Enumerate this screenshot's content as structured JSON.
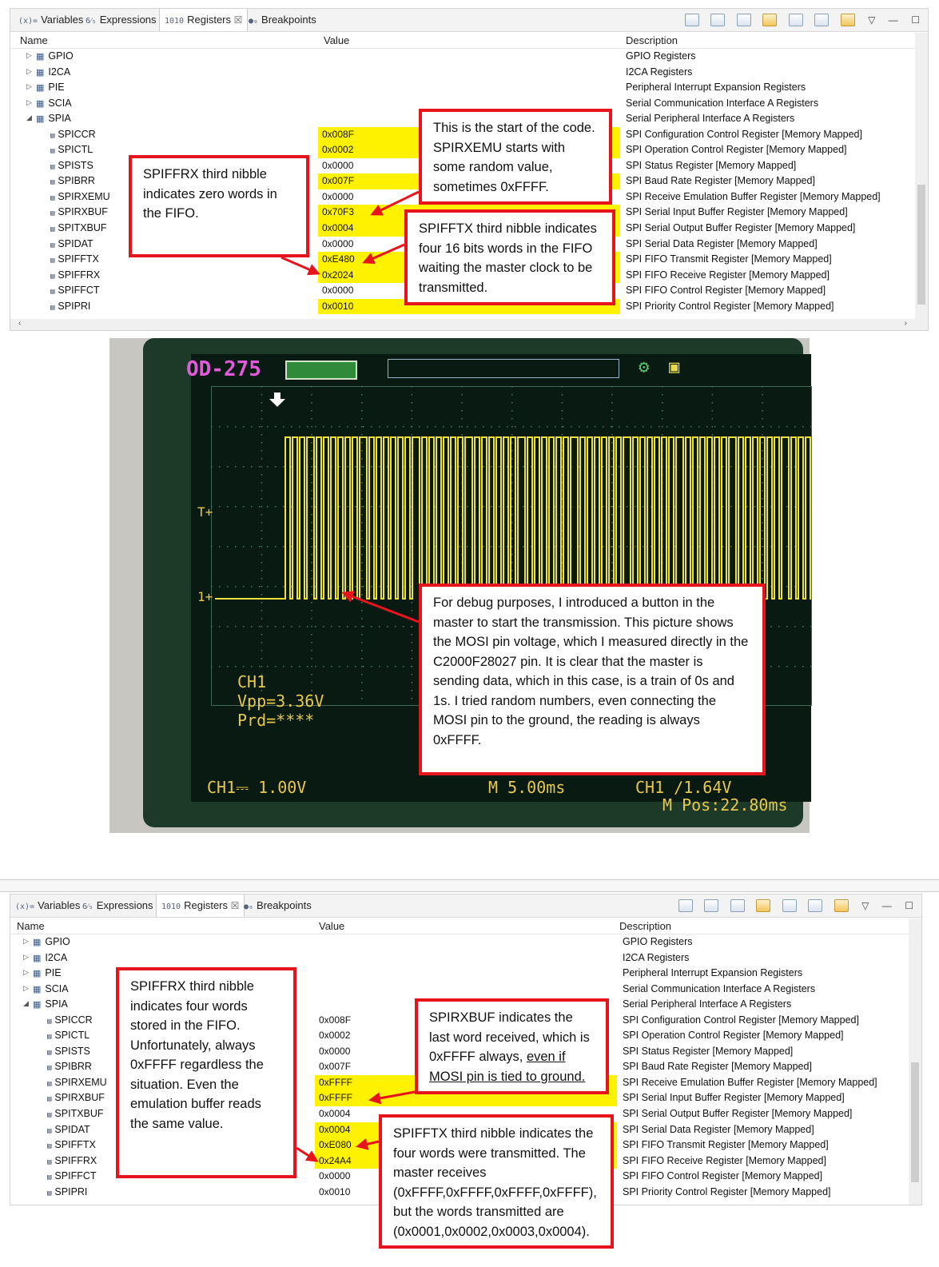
{
  "tabs": [
    {
      "icon": "(x)=",
      "label": "Variables"
    },
    {
      "icon": "6⁄₅",
      "label": "Expressions"
    },
    {
      "icon": "1010",
      "label": "Registers",
      "close": "☒"
    },
    {
      "icon": "●₀",
      "label": "Breakpoints"
    }
  ],
  "columns": {
    "name": "Name",
    "value": "Value",
    "description": "Description"
  },
  "groups": [
    {
      "name": "GPIO",
      "desc": "GPIO Registers"
    },
    {
      "name": "I2CA",
      "desc": "I2CA Registers"
    },
    {
      "name": "PIE",
      "desc": "Peripheral Interrupt Expansion Registers"
    },
    {
      "name": "SCIA",
      "desc": "Serial Communication Interface A Registers"
    },
    {
      "name": "SPIA",
      "desc": "Serial Peripheral Interface A Registers"
    }
  ],
  "registers": [
    {
      "name": "SPICCR",
      "desc": "SPI Configuration Control Register [Memory Mapped]"
    },
    {
      "name": "SPICTL",
      "desc": "SPI Operation Control Register [Memory Mapped]"
    },
    {
      "name": "SPISTS",
      "desc": "SPI Status Register [Memory Mapped]"
    },
    {
      "name": "SPIBRR",
      "desc": "SPI Baud Rate Register [Memory Mapped]"
    },
    {
      "name": "SPIRXEMU",
      "desc": "SPI Receive Emulation Buffer Register [Memory Mapped]"
    },
    {
      "name": "SPIRXBUF",
      "desc": "SPI Serial Input Buffer Register [Memory Mapped]"
    },
    {
      "name": "SPITXBUF",
      "desc": "SPI Serial Output Buffer Register [Memory Mapped]"
    },
    {
      "name": "SPIDAT",
      "desc": "SPI Serial Data Register [Memory Mapped]"
    },
    {
      "name": "SPIFFTX",
      "desc": "SPI FIFO Transmit Register [Memory Mapped]"
    },
    {
      "name": "SPIFFRX",
      "desc": "SPI FIFO Receive Register [Memory Mapped]"
    },
    {
      "name": "SPIFFCT",
      "desc": "SPI FIFO Control Register [Memory Mapped]"
    },
    {
      "name": "SPIPRI",
      "desc": "SPI Priority Control Register [Memory Mapped]"
    }
  ],
  "values_before": [
    {
      "v": "0x008F",
      "hl": true
    },
    {
      "v": "0x0002",
      "hl": true
    },
    {
      "v": "0x0000",
      "hl": false
    },
    {
      "v": "0x007F",
      "hl": true
    },
    {
      "v": "0x0000",
      "hl": false
    },
    {
      "v": "0x70F3",
      "hl": true
    },
    {
      "v": "0x0004",
      "hl": true
    },
    {
      "v": "0x0000",
      "hl": false
    },
    {
      "v": "0xE480",
      "hl": true
    },
    {
      "v": "0x2024",
      "hl": true
    },
    {
      "v": "0x0000",
      "hl": false
    },
    {
      "v": "0x0010",
      "hl": true
    }
  ],
  "values_after": [
    {
      "v": "0x008F",
      "hl": false
    },
    {
      "v": "0x0002",
      "hl": false
    },
    {
      "v": "0x0000",
      "hl": false
    },
    {
      "v": "0x007F",
      "hl": false
    },
    {
      "v": "0xFFFF",
      "hl": true
    },
    {
      "v": "0xFFFF",
      "hl": true
    },
    {
      "v": "0x0004",
      "hl": false
    },
    {
      "v": "0x0004",
      "hl": true
    },
    {
      "v": "0xE080",
      "hl": true
    },
    {
      "v": "0x24A4",
      "hl": true
    },
    {
      "v": "0x0000",
      "hl": false
    },
    {
      "v": "0x0010",
      "hl": false
    }
  ],
  "callouts": {
    "start": "This is the start of the code. SPIRXEMU starts with some random value, sometimes 0xFFFF.",
    "ffrx_zero": "SPIFFRX third nibble indicates zero words in the FIFO.",
    "fftx_four": "SPIFFTX third nibble indicates four 16 bits words in the FIFO waiting the master clock to be transmitted.",
    "debug": "For debug purposes, I introduced a button in the master to start the transmission. This picture shows the MOSI pin voltage, which I measured directly in the C2000F28027 pin. It is clear that the master is sending data, which in this case, is a train of 0s and 1s. I tried random numbers, even connecting the MOSI pin to the ground, the reading is always 0xFFFF.",
    "ffrx_four": "SPIFFRX third nibble indicates four words stored in the FIFO. Unfortunately, always 0xFFFF regardless the situation. Even the emulation buffer reads the same value.",
    "rxbuf_a": "SPIRXBUF indicates the last word received, which is 0xFFFF always, ",
    "rxbuf_b": "even if MOSI pin is tied to ground.",
    "fftx_tx": "SPIFFTX third nibble indicates the four words were transmitted. The master receives (0xFFFF,0xFFFF,0xFFFF,0xFFFF), but the words transmitted are (0x0001,0x0002,0x0003,0x0004)."
  },
  "scope": {
    "model": "OD-275",
    "channel": "CH1",
    "vpp": "Vpp=3.36V",
    "prd": "Prd=****",
    "volts": "CH1⎓ 1.00V",
    "time": "M 5.00ms",
    "trigger": "CH1 ∕1.64V",
    "pos": "M Pos:22.80ms",
    "t_marker": "T+",
    "ch_marker": "1+",
    "colors": {
      "trace": "#f0e13a",
      "label": "#e8c84a",
      "model": "#e05ad9",
      "grid": "#3e6a55",
      "screen": "#081a12"
    }
  }
}
